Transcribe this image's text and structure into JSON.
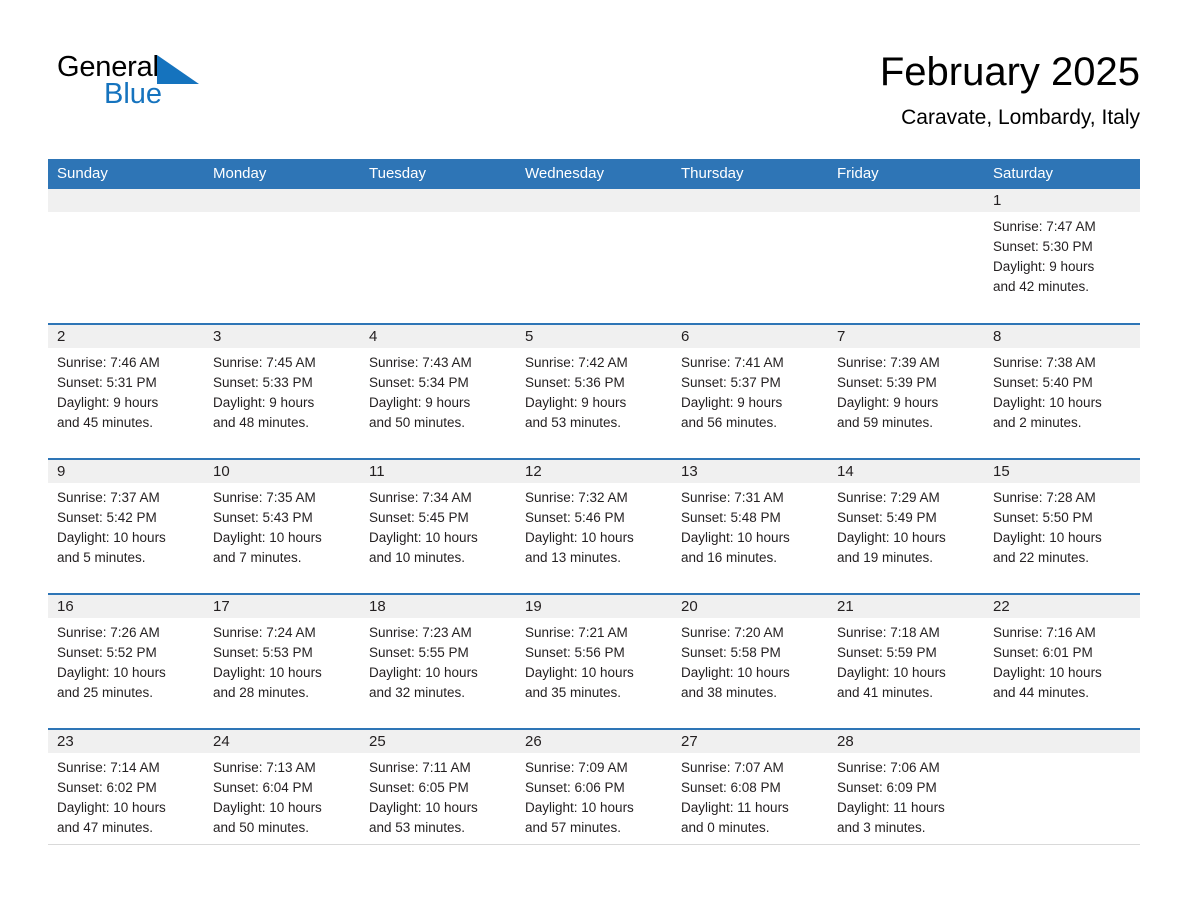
{
  "brand": {
    "name_part1": "General",
    "name_part2": "Blue",
    "accent_color": "#1573BE",
    "triangle_icon": "blue-triangle-icon"
  },
  "header": {
    "title": "February 2025",
    "subtitle": "Caravate, Lombardy, Italy"
  },
  "theme": {
    "header_blue": "#2E75B6",
    "daynum_strip_gray": "#F0F0F0",
    "text_black": "#231F20"
  },
  "weekday_headers": [
    "Sunday",
    "Monday",
    "Tuesday",
    "Wednesday",
    "Thursday",
    "Friday",
    "Saturday"
  ],
  "weeks": [
    [
      {
        "day": "",
        "sunrise": "",
        "sunset": "",
        "daylight_line1": "",
        "daylight_line2": "",
        "empty": true
      },
      {
        "day": "",
        "sunrise": "",
        "sunset": "",
        "daylight_line1": "",
        "daylight_line2": "",
        "empty": true
      },
      {
        "day": "",
        "sunrise": "",
        "sunset": "",
        "daylight_line1": "",
        "daylight_line2": "",
        "empty": true
      },
      {
        "day": "",
        "sunrise": "",
        "sunset": "",
        "daylight_line1": "",
        "daylight_line2": "",
        "empty": true
      },
      {
        "day": "",
        "sunrise": "",
        "sunset": "",
        "daylight_line1": "",
        "daylight_line2": "",
        "empty": true
      },
      {
        "day": "",
        "sunrise": "",
        "sunset": "",
        "daylight_line1": "",
        "daylight_line2": "",
        "empty": true
      },
      {
        "day": "1",
        "sunrise": "Sunrise: 7:47 AM",
        "sunset": "Sunset: 5:30 PM",
        "daylight_line1": "Daylight: 9 hours",
        "daylight_line2": "and 42 minutes.",
        "empty": false
      }
    ],
    [
      {
        "day": "2",
        "sunrise": "Sunrise: 7:46 AM",
        "sunset": "Sunset: 5:31 PM",
        "daylight_line1": "Daylight: 9 hours",
        "daylight_line2": "and 45 minutes.",
        "empty": false
      },
      {
        "day": "3",
        "sunrise": "Sunrise: 7:45 AM",
        "sunset": "Sunset: 5:33 PM",
        "daylight_line1": "Daylight: 9 hours",
        "daylight_line2": "and 48 minutes.",
        "empty": false
      },
      {
        "day": "4",
        "sunrise": "Sunrise: 7:43 AM",
        "sunset": "Sunset: 5:34 PM",
        "daylight_line1": "Daylight: 9 hours",
        "daylight_line2": "and 50 minutes.",
        "empty": false
      },
      {
        "day": "5",
        "sunrise": "Sunrise: 7:42 AM",
        "sunset": "Sunset: 5:36 PM",
        "daylight_line1": "Daylight: 9 hours",
        "daylight_line2": "and 53 minutes.",
        "empty": false
      },
      {
        "day": "6",
        "sunrise": "Sunrise: 7:41 AM",
        "sunset": "Sunset: 5:37 PM",
        "daylight_line1": "Daylight: 9 hours",
        "daylight_line2": "and 56 minutes.",
        "empty": false
      },
      {
        "day": "7",
        "sunrise": "Sunrise: 7:39 AM",
        "sunset": "Sunset: 5:39 PM",
        "daylight_line1": "Daylight: 9 hours",
        "daylight_line2": "and 59 minutes.",
        "empty": false
      },
      {
        "day": "8",
        "sunrise": "Sunrise: 7:38 AM",
        "sunset": "Sunset: 5:40 PM",
        "daylight_line1": "Daylight: 10 hours",
        "daylight_line2": "and 2 minutes.",
        "empty": false
      }
    ],
    [
      {
        "day": "9",
        "sunrise": "Sunrise: 7:37 AM",
        "sunset": "Sunset: 5:42 PM",
        "daylight_line1": "Daylight: 10 hours",
        "daylight_line2": "and 5 minutes.",
        "empty": false
      },
      {
        "day": "10",
        "sunrise": "Sunrise: 7:35 AM",
        "sunset": "Sunset: 5:43 PM",
        "daylight_line1": "Daylight: 10 hours",
        "daylight_line2": "and 7 minutes.",
        "empty": false
      },
      {
        "day": "11",
        "sunrise": "Sunrise: 7:34 AM",
        "sunset": "Sunset: 5:45 PM",
        "daylight_line1": "Daylight: 10 hours",
        "daylight_line2": "and 10 minutes.",
        "empty": false
      },
      {
        "day": "12",
        "sunrise": "Sunrise: 7:32 AM",
        "sunset": "Sunset: 5:46 PM",
        "daylight_line1": "Daylight: 10 hours",
        "daylight_line2": "and 13 minutes.",
        "empty": false
      },
      {
        "day": "13",
        "sunrise": "Sunrise: 7:31 AM",
        "sunset": "Sunset: 5:48 PM",
        "daylight_line1": "Daylight: 10 hours",
        "daylight_line2": "and 16 minutes.",
        "empty": false
      },
      {
        "day": "14",
        "sunrise": "Sunrise: 7:29 AM",
        "sunset": "Sunset: 5:49 PM",
        "daylight_line1": "Daylight: 10 hours",
        "daylight_line2": "and 19 minutes.",
        "empty": false
      },
      {
        "day": "15",
        "sunrise": "Sunrise: 7:28 AM",
        "sunset": "Sunset: 5:50 PM",
        "daylight_line1": "Daylight: 10 hours",
        "daylight_line2": "and 22 minutes.",
        "empty": false
      }
    ],
    [
      {
        "day": "16",
        "sunrise": "Sunrise: 7:26 AM",
        "sunset": "Sunset: 5:52 PM",
        "daylight_line1": "Daylight: 10 hours",
        "daylight_line2": "and 25 minutes.",
        "empty": false
      },
      {
        "day": "17",
        "sunrise": "Sunrise: 7:24 AM",
        "sunset": "Sunset: 5:53 PM",
        "daylight_line1": "Daylight: 10 hours",
        "daylight_line2": "and 28 minutes.",
        "empty": false
      },
      {
        "day": "18",
        "sunrise": "Sunrise: 7:23 AM",
        "sunset": "Sunset: 5:55 PM",
        "daylight_line1": "Daylight: 10 hours",
        "daylight_line2": "and 32 minutes.",
        "empty": false
      },
      {
        "day": "19",
        "sunrise": "Sunrise: 7:21 AM",
        "sunset": "Sunset: 5:56 PM",
        "daylight_line1": "Daylight: 10 hours",
        "daylight_line2": "and 35 minutes.",
        "empty": false
      },
      {
        "day": "20",
        "sunrise": "Sunrise: 7:20 AM",
        "sunset": "Sunset: 5:58 PM",
        "daylight_line1": "Daylight: 10 hours",
        "daylight_line2": "and 38 minutes.",
        "empty": false
      },
      {
        "day": "21",
        "sunrise": "Sunrise: 7:18 AM",
        "sunset": "Sunset: 5:59 PM",
        "daylight_line1": "Daylight: 10 hours",
        "daylight_line2": "and 41 minutes.",
        "empty": false
      },
      {
        "day": "22",
        "sunrise": "Sunrise: 7:16 AM",
        "sunset": "Sunset: 6:01 PM",
        "daylight_line1": "Daylight: 10 hours",
        "daylight_line2": "and 44 minutes.",
        "empty": false
      }
    ],
    [
      {
        "day": "23",
        "sunrise": "Sunrise: 7:14 AM",
        "sunset": "Sunset: 6:02 PM",
        "daylight_line1": "Daylight: 10 hours",
        "daylight_line2": "and 47 minutes.",
        "empty": false
      },
      {
        "day": "24",
        "sunrise": "Sunrise: 7:13 AM",
        "sunset": "Sunset: 6:04 PM",
        "daylight_line1": "Daylight: 10 hours",
        "daylight_line2": "and 50 minutes.",
        "empty": false
      },
      {
        "day": "25",
        "sunrise": "Sunrise: 7:11 AM",
        "sunset": "Sunset: 6:05 PM",
        "daylight_line1": "Daylight: 10 hours",
        "daylight_line2": "and 53 minutes.",
        "empty": false
      },
      {
        "day": "26",
        "sunrise": "Sunrise: 7:09 AM",
        "sunset": "Sunset: 6:06 PM",
        "daylight_line1": "Daylight: 10 hours",
        "daylight_line2": "and 57 minutes.",
        "empty": false
      },
      {
        "day": "27",
        "sunrise": "Sunrise: 7:07 AM",
        "sunset": "Sunset: 6:08 PM",
        "daylight_line1": "Daylight: 11 hours",
        "daylight_line2": "and 0 minutes.",
        "empty": false
      },
      {
        "day": "28",
        "sunrise": "Sunrise: 7:06 AM",
        "sunset": "Sunset: 6:09 PM",
        "daylight_line1": "Daylight: 11 hours",
        "daylight_line2": "and 3 minutes.",
        "empty": false
      },
      {
        "day": "",
        "sunrise": "",
        "sunset": "",
        "daylight_line1": "",
        "daylight_line2": "",
        "empty": true
      }
    ]
  ]
}
